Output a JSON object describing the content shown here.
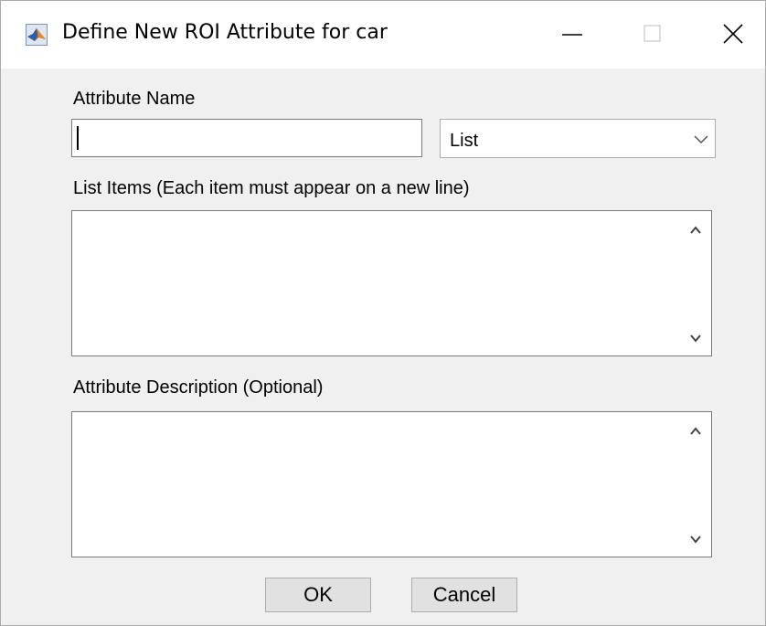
{
  "window": {
    "title": "Define New ROI Attribute for car",
    "icon": "matlab-logo-icon"
  },
  "form": {
    "attribute_name_label": "Attribute Name",
    "attribute_name_value": "",
    "type_selected": "List",
    "list_items_label": "List Items (Each item must appear on a new line)",
    "list_items_value": "",
    "description_label": "Attribute Description (Optional)",
    "description_value": ""
  },
  "buttons": {
    "ok": "OK",
    "cancel": "Cancel"
  },
  "colors": {
    "dialog_background": "#f0f0f0",
    "titlebar_background": "#ffffff",
    "button_face": "#e1e1e1",
    "border": "#7a7a7a"
  }
}
